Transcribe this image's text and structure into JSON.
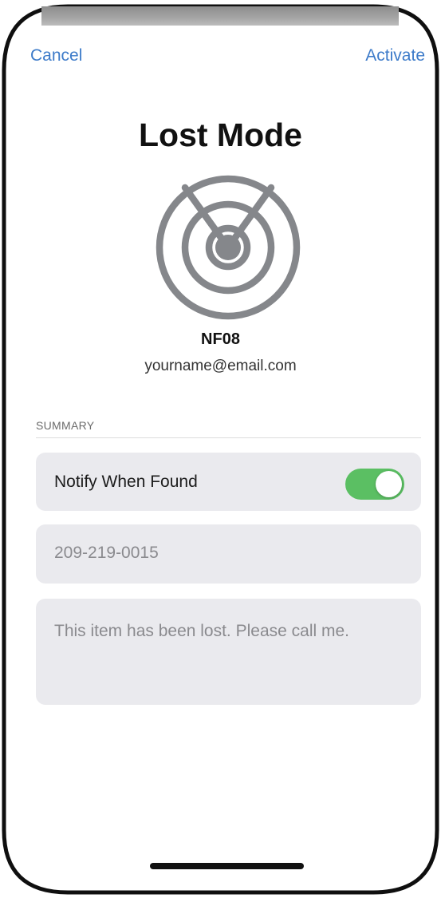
{
  "nav": {
    "cancel_label": "Cancel",
    "activate_label": "Activate"
  },
  "header": {
    "title": "Lost Mode",
    "icon": "radar-location-icon"
  },
  "device": {
    "name": "NF08",
    "email": "yourname@email.com"
  },
  "summary": {
    "section_label": "SUMMARY",
    "notify_label": "Notify When Found",
    "notify_enabled": true,
    "phone_number": "209-219-0015",
    "message": "This item has been lost. Please call me."
  },
  "colors": {
    "accent": "#3d7bc9",
    "toggle_on": "#5bbf63",
    "icon_gray": "#85878b",
    "card_bg": "#eaeaee"
  }
}
